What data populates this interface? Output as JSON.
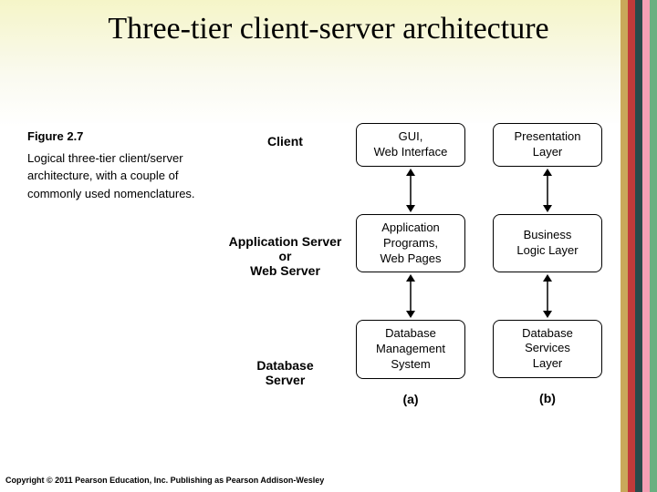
{
  "title": "Three-tier client-server architecture",
  "figure": {
    "number": "Figure 2.7",
    "caption": "Logical three-tier client/server architecture, with a couple of commonly used nomenclatures."
  },
  "tiers": {
    "labels": {
      "client": "Client",
      "app_server_line1": "Application Server",
      "app_server_line2": "or",
      "app_server_line3": "Web Server",
      "db_server_line1": "Database",
      "db_server_line2": "Server"
    }
  },
  "columns": {
    "a": {
      "label": "(a)",
      "top": "GUI,\nWeb Interface",
      "mid": "Application\nPrograms,\nWeb Pages",
      "bot": "Database\nManagement\nSystem"
    },
    "b": {
      "label": "(b)",
      "top": "Presentation\nLayer",
      "mid": "Business\nLogic Layer",
      "bot": "Database\nServices\nLayer"
    }
  },
  "copyright": "Copyright © 2011 Pearson Education, Inc. Publishing as Pearson Addison-Wesley"
}
